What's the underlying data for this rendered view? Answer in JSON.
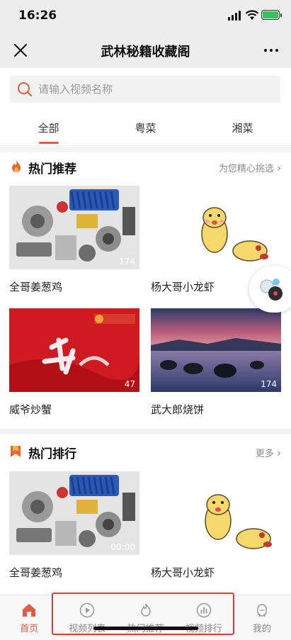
{
  "status_bar": {
    "time": "16:26"
  },
  "nav": {
    "title": "武林秘籍收藏阁"
  },
  "search": {
    "placeholder": "请输入视频名称"
  },
  "tabs": [
    {
      "label": "全部",
      "active": true
    },
    {
      "label": "粤菜",
      "active": false
    },
    {
      "label": "湘菜",
      "active": false
    }
  ],
  "hot_recommend": {
    "title": "热门推荐",
    "more": "为您精心挑选",
    "items": [
      {
        "title": "全哥姜葱鸡",
        "duration": "174"
      },
      {
        "title": "杨大哥小龙虾",
        "duration": ""
      },
      {
        "title": "威爷炒蟹",
        "duration": "47"
      },
      {
        "title": "武大郎烧饼",
        "duration": "174"
      }
    ]
  },
  "hot_ranking": {
    "title": "热门排行",
    "more": "更多",
    "items": [
      {
        "title": "全哥姜葱鸡",
        "duration": "00:00"
      },
      {
        "title": "杨大哥小龙虾",
        "duration": ""
      }
    ]
  },
  "tabbar": [
    {
      "label": "首页",
      "icon": "home-icon",
      "active": true
    },
    {
      "label": "视频列表",
      "icon": "play-circle-icon",
      "active": false
    },
    {
      "label": "热门推荐",
      "icon": "flame-icon",
      "active": false
    },
    {
      "label": "视频排行",
      "icon": "bar-chart-icon",
      "active": false
    },
    {
      "label": "我的",
      "icon": "user-icon",
      "active": false
    }
  ],
  "colors": {
    "accent": "#e45a3a",
    "highlight": "#e23a3a"
  }
}
